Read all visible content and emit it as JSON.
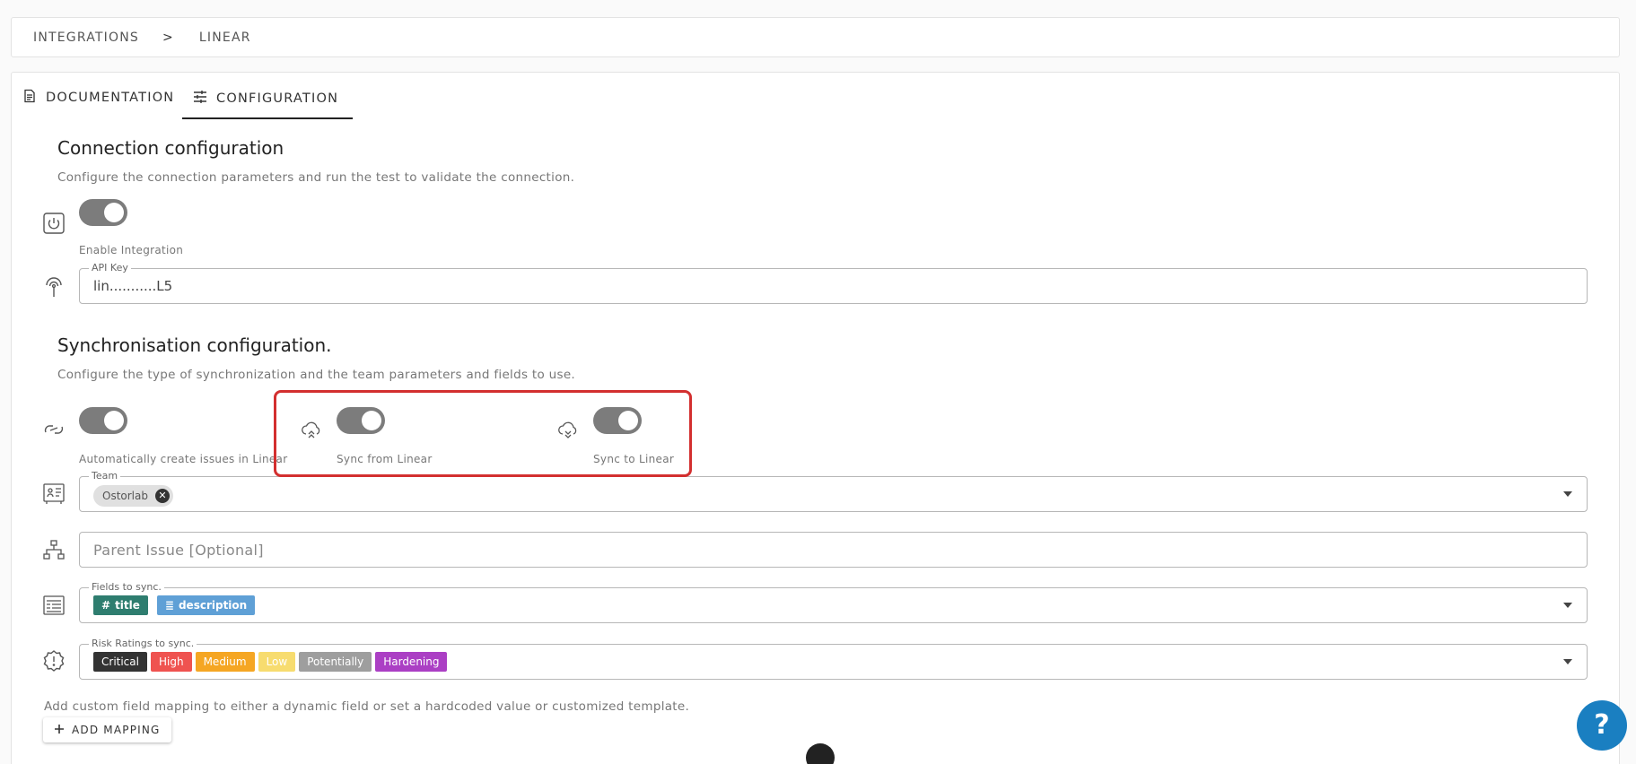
{
  "breadcrumb": {
    "root": "INTEGRATIONS",
    "separator": ">",
    "current": "LINEAR"
  },
  "tabs": [
    {
      "label": "DOCUMENTATION",
      "icon": "document-icon"
    },
    {
      "label": "CONFIGURATION",
      "icon": "sliders-icon",
      "active": true
    }
  ],
  "connection": {
    "title": "Connection configuration",
    "description": "Configure the connection parameters and run the test to validate the connection.",
    "enable_label": "Enable Integration",
    "api_key_legend": "API Key",
    "api_key_value": "lin...........L5"
  },
  "sync": {
    "title": "Synchronisation configuration.",
    "description": "Configure the type of synchronization and the team parameters and fields to use.",
    "auto_create_label": "Automatically create issues in Linear",
    "sync_from_label": "Sync from Linear",
    "sync_to_label": "Sync to Linear",
    "team_legend": "Team",
    "team_chip": "Ostorlab",
    "team_chip_remove": "✕",
    "parent_issue_placeholder": "Parent Issue [Optional]",
    "fields_legend": "Fields to sync.",
    "fields": [
      {
        "label": "title",
        "icon": "#",
        "color": "#2e7d6f"
      },
      {
        "label": "description",
        "icon": "≣",
        "color": "#5fa0d6"
      }
    ],
    "risk_legend": "Risk Ratings to sync.",
    "risks": [
      {
        "label": "Critical",
        "color": "#333333"
      },
      {
        "label": "High",
        "color": "#ef5350"
      },
      {
        "label": "Medium",
        "color": "#f5a623"
      },
      {
        "label": "Low",
        "color": "#f7dc6f"
      },
      {
        "label": "Potentially",
        "color": "#9e9e9e"
      },
      {
        "label": "Hardening",
        "color": "#ab3fc4"
      }
    ]
  },
  "mapping": {
    "description": "Add custom field mapping to either a dynamic field or set a hardcoded value or customized template.",
    "add_button": "ADD MAPPING"
  },
  "help_button": "?"
}
